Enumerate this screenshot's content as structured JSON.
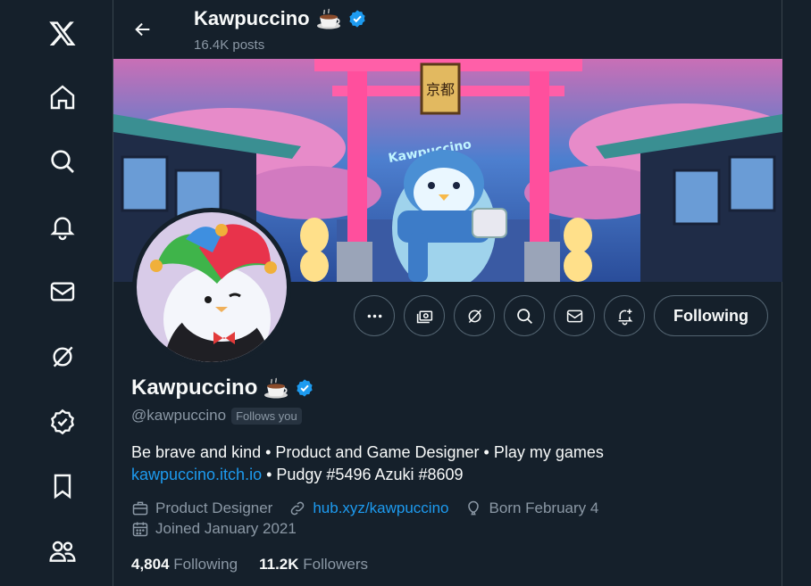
{
  "header": {
    "name": "Kawpuccino",
    "posts": "16.4K posts"
  },
  "profile": {
    "name": "Kawpuccino",
    "handle": "@kawpuccino",
    "follows_you": "Follows you",
    "bio_line1": "Be brave and kind • Product and Game Designer • Play my games",
    "bio_link": "kawpuccino.itch.io",
    "bio_line2_rest": " • Pudgy #5496 Azuki #8609",
    "profession": "Product Designer",
    "website": "hub.xyz/kawpuccino",
    "birthday": "Born February 4",
    "joined": "Joined January 2021",
    "following_count": "4,804",
    "following_label": "Following",
    "followers_count": "11.2K",
    "followers_label": "Followers"
  },
  "banner": {
    "sign_text": "Kawpuccino",
    "gate_plaque": "京都"
  },
  "actions": {
    "follow_label": "Following"
  },
  "nav": {
    "icons": [
      "x-logo-icon",
      "home-icon",
      "search-icon",
      "notifications-icon",
      "messages-icon",
      "grok-icon",
      "verified-icon",
      "bookmarks-icon",
      "communities-icon"
    ]
  },
  "colors": {
    "background": "#15202b",
    "accent": "#1d9bf0",
    "muted": "#8b98a5",
    "border": "#38444d"
  }
}
